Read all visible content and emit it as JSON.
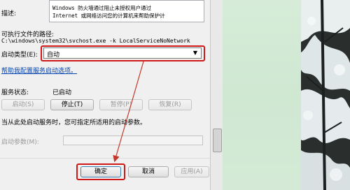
{
  "description": {
    "label": "描述:",
    "line1": "Windows 防火墙通过阻止未授权用户通过",
    "line2": "Internet 或网络访问您的计算机来帮助保护计"
  },
  "path": {
    "label": "可执行文件的路径:",
    "value": "C:\\windows\\system32\\svchost.exe -k LocalServiceNoNetwork"
  },
  "startup_type": {
    "label": "启动类型(E):",
    "selected": "自动"
  },
  "help_link": "帮助我配置服务启动选项。",
  "service_status": {
    "label": "服务状态:",
    "value": "已启动"
  },
  "control_buttons": {
    "start": "启动(S)",
    "stop": "停止(T)",
    "pause": "暂停(P)",
    "resume": "恢复(R)"
  },
  "hint_text": "当从此处启动服务时，您可指定所适用的启动参数。",
  "start_params": {
    "label": "启动参数(M):",
    "value": ""
  },
  "footer_buttons": {
    "ok": "确定",
    "cancel": "取消",
    "apply": "应用(A)"
  },
  "colors": {
    "highlight": "#d01818",
    "link": "#0645ad"
  }
}
